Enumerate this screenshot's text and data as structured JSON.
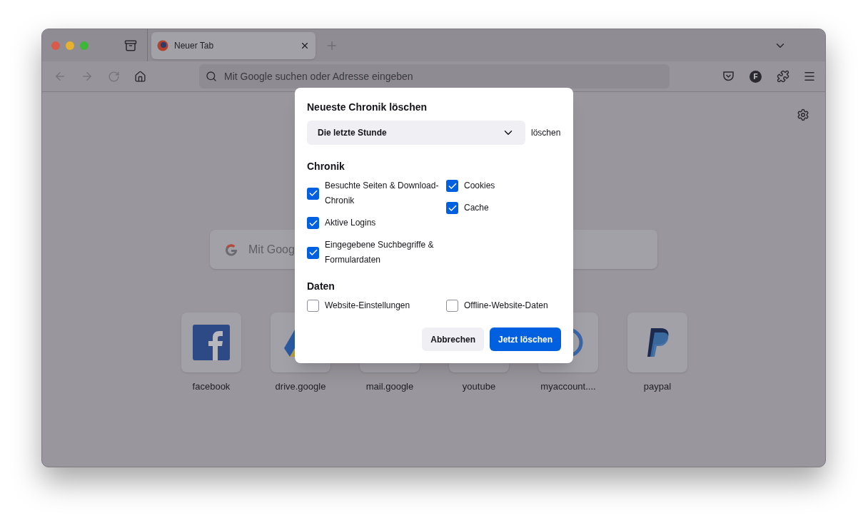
{
  "tabs": [
    {
      "label": "Neuer Tab",
      "selected": true
    }
  ],
  "address_bar": {
    "placeholder": "Mit Google suchen oder Adresse eingeben"
  },
  "account_initial": "F",
  "new_tab": {
    "search_placeholder": "Mit Goog",
    "shortcuts": [
      {
        "label": "facebook"
      },
      {
        "label": "drive.google"
      },
      {
        "label": "mail.google"
      },
      {
        "label": "youtube"
      },
      {
        "label": "myaccount...."
      },
      {
        "label": "paypal"
      }
    ]
  },
  "dialog": {
    "title": "Neueste Chronik löschen",
    "range": "Die letzte Stunde",
    "range_suffix": "löschen",
    "sections": [
      {
        "heading": "Chronik",
        "columns": [
          [
            {
              "label": "Besuchte Seiten & Download-Chronik",
              "checked": true
            },
            {
              "label": "Aktive Logins",
              "checked": true
            },
            {
              "label": "Eingegebene Suchbegriffe & Formulardaten",
              "checked": true
            }
          ],
          [
            {
              "label": "Cookies",
              "checked": true
            },
            {
              "label": "Cache",
              "checked": true
            }
          ]
        ]
      },
      {
        "heading": "Daten",
        "columns": [
          [
            {
              "label": "Website-Einstellungen",
              "checked": false
            }
          ],
          [
            {
              "label": "Offline-Website-Daten",
              "checked": false
            }
          ]
        ]
      }
    ],
    "buttons": [
      {
        "label": "Abbrechen",
        "kind": "secondary"
      },
      {
        "label": "Jetzt löschen",
        "kind": "primary"
      }
    ]
  }
}
